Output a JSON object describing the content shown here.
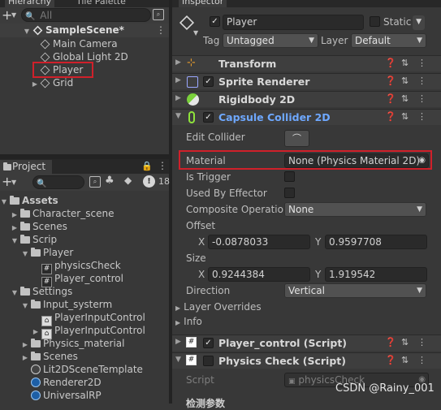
{
  "hierarchy": {
    "tab_label": "Hierarchy",
    "tab2_label": "Tile Palette",
    "search_placeholder": "All",
    "scene_name": "SampleScene*",
    "items": [
      "Main Camera",
      "Global Light 2D",
      "Player",
      "Grid"
    ]
  },
  "project": {
    "tab_label": "Project",
    "badge": "18",
    "tree": [
      {
        "label": "Assets",
        "indent": 0,
        "type": "folder-root",
        "expanded": true
      },
      {
        "label": "Character_scene",
        "indent": 1,
        "type": "folder",
        "expanded": false
      },
      {
        "label": "Scenes",
        "indent": 1,
        "type": "folder",
        "expanded": false
      },
      {
        "label": "Scrip",
        "indent": 1,
        "type": "folder",
        "expanded": true
      },
      {
        "label": "Player",
        "indent": 2,
        "type": "folder",
        "expanded": true
      },
      {
        "label": "physicsCheck",
        "indent": 3,
        "type": "script"
      },
      {
        "label": "Player_control",
        "indent": 3,
        "type": "script"
      },
      {
        "label": "Settings",
        "indent": 1,
        "type": "folder",
        "expanded": true
      },
      {
        "label": "Input_systerm",
        "indent": 2,
        "type": "folder",
        "expanded": true
      },
      {
        "label": "PlayerInputControl",
        "indent": 3,
        "type": "input"
      },
      {
        "label": "PlayerInputControl",
        "indent": 3,
        "type": "input-expandable"
      },
      {
        "label": "Physics_material",
        "indent": 2,
        "type": "folder",
        "expanded": false
      },
      {
        "label": "Scenes",
        "indent": 2,
        "type": "folder",
        "expanded": false
      },
      {
        "label": "Lit2DSceneTemplate",
        "indent": 2,
        "type": "template"
      },
      {
        "label": "Renderer2D",
        "indent": 2,
        "type": "asset"
      },
      {
        "label": "UniversalRP",
        "indent": 2,
        "type": "asset"
      }
    ]
  },
  "inspector": {
    "tab_label": "Inspector",
    "object_name": "Player",
    "static_label": "Static",
    "tag_label": "Tag",
    "tag_value": "Untagged",
    "layer_label": "Layer",
    "layer_value": "Default",
    "components": [
      {
        "name": "Transform",
        "checkbox": false
      },
      {
        "name": "Sprite Renderer",
        "checkbox": true
      },
      {
        "name": "Rigidbody 2D",
        "checkbox": false
      },
      {
        "name": "Capsule Collider 2D",
        "checkbox": true
      }
    ],
    "capsule": {
      "edit_collider_label": "Edit Collider",
      "material_label": "Material",
      "material_value": "None (Physics Material 2D)",
      "is_trigger_label": "Is Trigger",
      "used_by_effector_label": "Used By Effector",
      "composite_label": "Composite Operation",
      "composite_value": "None",
      "offset_label": "Offset",
      "offset_x": "-0.0878033",
      "offset_y": "0.9597708",
      "size_label": "Size",
      "size_x": "0.9244384",
      "size_y": "1.919542",
      "x_label": "X",
      "y_label": "Y",
      "direction_label": "Direction",
      "direction_value": "Vertical",
      "layer_overrides_label": "Layer Overrides",
      "info_label": "Info"
    },
    "player_control": "Player_control (Script)",
    "physics_check": "Physics Check (Script)",
    "script_label": "Script",
    "script_value": "physicsCheck",
    "bottom_text": "检测参数"
  },
  "watermark": "CSDN @Rainy_001"
}
